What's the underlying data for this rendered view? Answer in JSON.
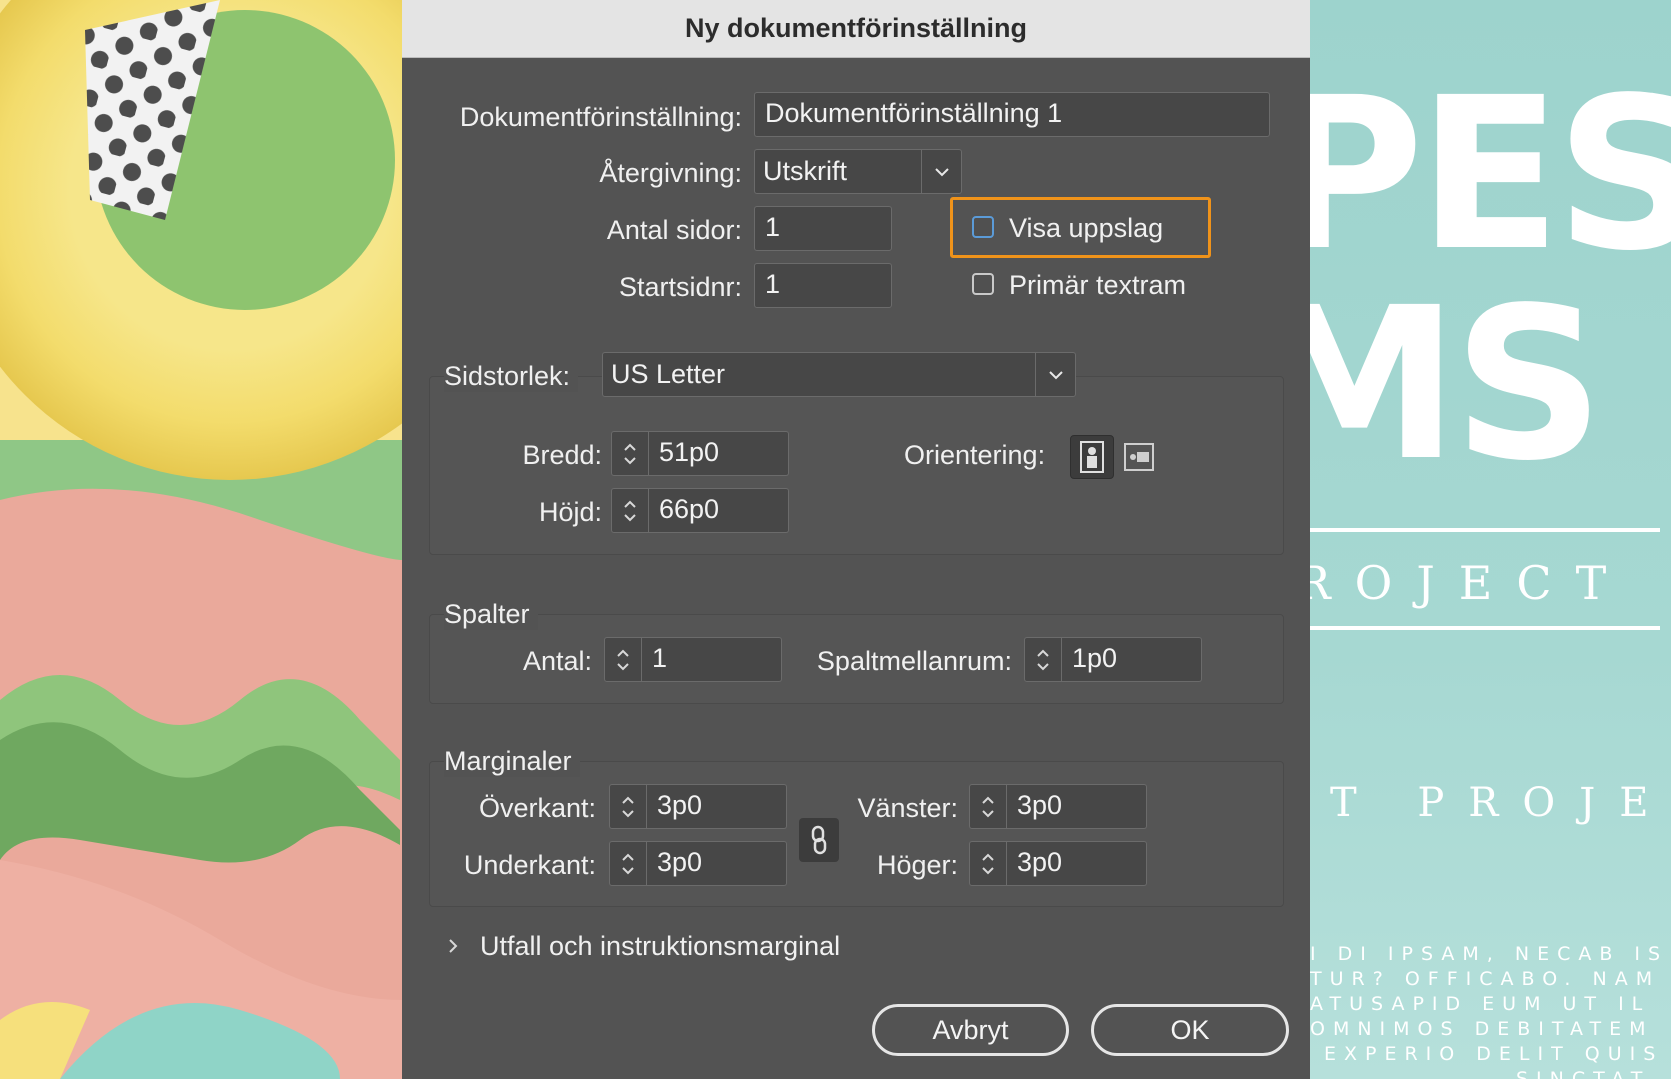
{
  "dialog": {
    "title": "Ny dokumentförinställning",
    "preset_label": "Dokumentförinställning:",
    "preset_value": "Dokumentförinställning 1",
    "intent_label": "Återgivning:",
    "intent_value": "Utskrift",
    "pages_label": "Antal sidor:",
    "pages_value": "1",
    "start_label": "Startsidnr:",
    "start_value": "1",
    "facing_label": "Visa uppslag",
    "facing_checked": false,
    "primary_frame_label": "Primär textram",
    "primary_frame_checked": false,
    "highlight_color": "#f0931a"
  },
  "page_size": {
    "label": "Sidstorlek:",
    "value": "US Letter",
    "width_label": "Bredd:",
    "width_value": "51p0",
    "height_label": "Höjd:",
    "height_value": "66p0",
    "orientation_label": "Orientering:",
    "orientation_selected": "portrait"
  },
  "columns": {
    "title": "Spalter",
    "count_label": "Antal:",
    "count_value": "1",
    "gutter_label": "Spaltmellanrum:",
    "gutter_value": "1p0"
  },
  "margins": {
    "title": "Marginaler",
    "top_label": "Överkant:",
    "top_value": "3p0",
    "bottom_label": "Underkant:",
    "bottom_value": "3p0",
    "left_label": "Vänster:",
    "left_value": "3p0",
    "right_label": "Höger:",
    "right_value": "3p0"
  },
  "bleed": {
    "label": "Utfall och instruktionsmarginal"
  },
  "buttons": {
    "cancel": "Avbryt",
    "ok": "OK"
  },
  "background_art": {
    "big_line1": "PES",
    "big_line2": "MS",
    "spaced1": "ROJECT",
    "spaced2": "T PROJECT",
    "small_lines": [
      "I DI IPSAM, NECAB IS",
      "TUR? OFFICABO. NAM",
      "ATUSAPID EUM UT IL",
      "OMNIMOS DEBITATEM",
      "EXPERIO DELIT QUIS",
      "SINCTAT"
    ]
  }
}
